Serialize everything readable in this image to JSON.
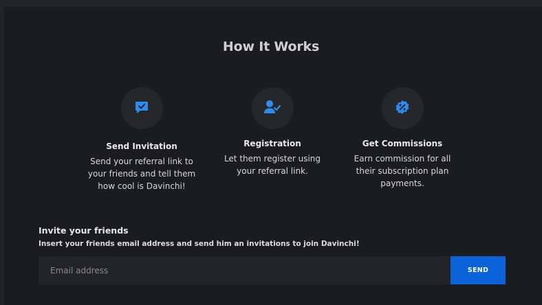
{
  "section": {
    "title": "How It Works"
  },
  "steps": [
    {
      "icon": "chat-check-icon",
      "title": "Send Invitation",
      "desc": [
        "Send your referral link to",
        "your friends and tell them",
        "how cool is Davinchi!"
      ]
    },
    {
      "icon": "user-check-icon",
      "title": "Registration",
      "desc": [
        "Let them register using",
        "your referral link."
      ]
    },
    {
      "icon": "percent-badge-icon",
      "title": "Get Commissions",
      "desc": [
        "Earn commission for all",
        "their subscription plan",
        "payments."
      ]
    }
  ],
  "invite": {
    "title": "Invite your friends",
    "subtitle": "Insert your friends email address and send him an invitations to join Davinchi!",
    "email_placeholder": "Email address",
    "send_label": "SEND"
  },
  "colors": {
    "accent": "#0a63d8",
    "icon_blue": "#2e8cf0",
    "background": "#1b1c1f"
  }
}
